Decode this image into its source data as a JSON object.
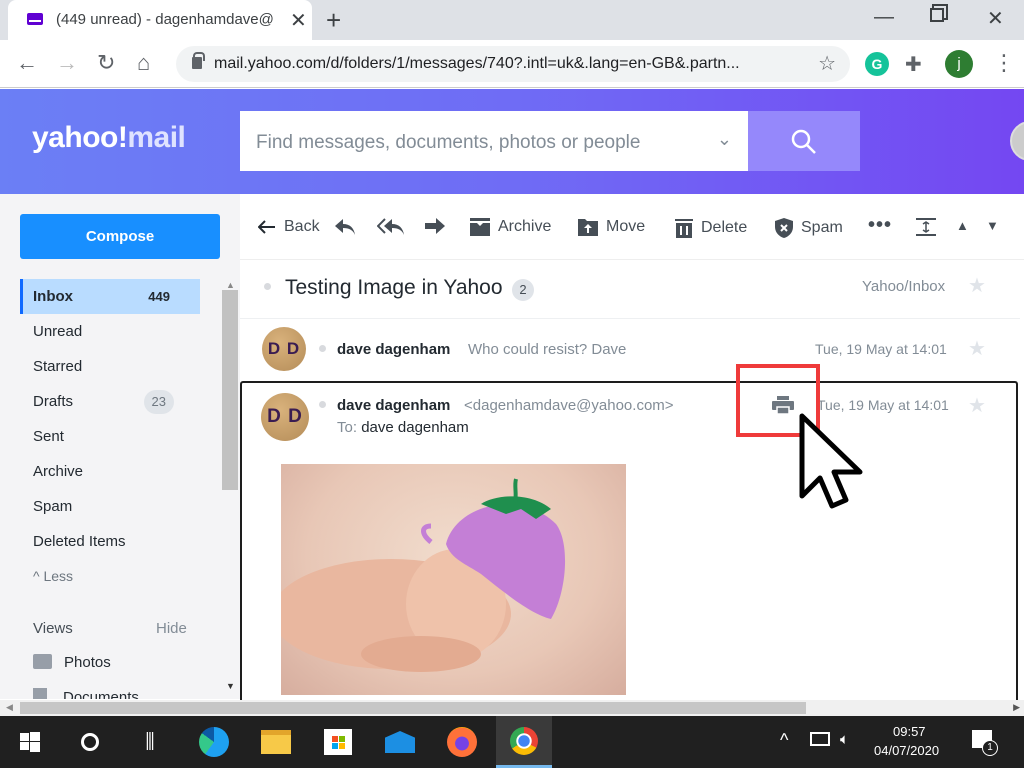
{
  "browser": {
    "tab_title": "(449 unread) - dagenhamdave@",
    "url": "mail.yahoo.com/d/folders/1/messages/740?.intl=uk&.lang=en-GB&.partn...",
    "profile_initial": "j",
    "icons": [
      "back-icon",
      "forward-icon",
      "reload-icon",
      "home-icon",
      "lock-icon",
      "bookmark-star-icon",
      "grammarly-icon",
      "extensions-icon",
      "profile-icon",
      "menu-icon"
    ]
  },
  "header": {
    "logo_yahoo": "yahoo!",
    "logo_mail": "mail",
    "search_placeholder": "Find messages, documents, photos or people"
  },
  "sidebar": {
    "compose": "Compose",
    "folders": [
      {
        "label": "Inbox",
        "count": "449",
        "active": true
      },
      {
        "label": "Unread"
      },
      {
        "label": "Starred"
      },
      {
        "label": "Drafts",
        "count": "23"
      },
      {
        "label": "Sent"
      },
      {
        "label": "Archive"
      },
      {
        "label": "Spam"
      },
      {
        "label": "Deleted Items"
      }
    ],
    "less": "Less",
    "views_label": "Views",
    "views_hide": "Hide",
    "views": [
      {
        "label": "Photos"
      },
      {
        "label": "Documents"
      }
    ]
  },
  "toolbar": {
    "back": "Back",
    "archive": "Archive",
    "move": "Move",
    "delete": "Delete",
    "spam": "Spam"
  },
  "thread": {
    "subject": "Testing Image in Yahoo",
    "message_count": "2",
    "folder": "Yahoo/Inbox",
    "messages": [
      {
        "initials": "D D",
        "sender": "dave dagenham",
        "snippet": "Who could resist? Dave",
        "date": "Tue, 19 May at 14:01"
      },
      {
        "initials": "D D",
        "sender": "dave dagenham",
        "email": "<dagenhamdave@yahoo.com>",
        "to_label": "To:",
        "to": "dave dagenham",
        "date": "Tue, 19 May at 14:01",
        "attachment": "sleeping baby in purple flower hat photo"
      }
    ]
  },
  "annotation": {
    "highlight": "print-button",
    "color": "#ef3a3a"
  },
  "taskbar": {
    "apps": [
      "start",
      "cortana",
      "task-view",
      "edge",
      "file-explorer",
      "store",
      "mail",
      "firefox",
      "chrome"
    ],
    "time": "09:57",
    "date": "04/07/2020",
    "notifications": "1"
  }
}
